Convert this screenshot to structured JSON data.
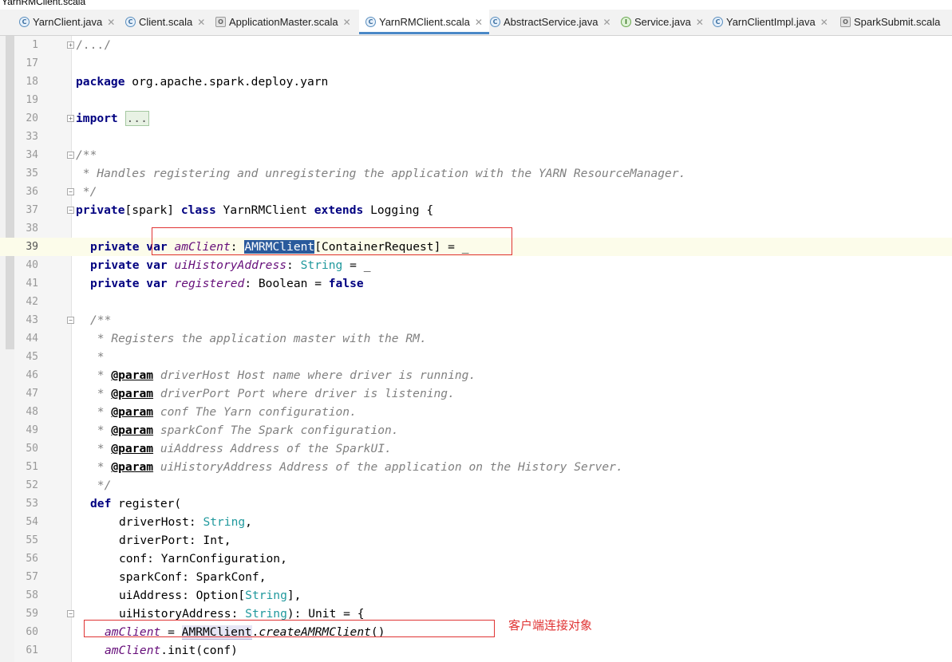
{
  "window": {
    "title": "YarnRMClient.scala"
  },
  "tabs": [
    {
      "label": "YarnClient.java",
      "icon": "class-icon",
      "active": false
    },
    {
      "label": "Client.scala",
      "icon": "class-icon",
      "active": false
    },
    {
      "label": "ApplicationMaster.scala",
      "icon": "object-icon",
      "active": false
    },
    {
      "label": "YarnRMClient.scala",
      "icon": "class-icon",
      "active": true
    },
    {
      "label": "AbstractService.java",
      "icon": "class-icon",
      "active": false
    },
    {
      "label": "Service.java",
      "icon": "interface-icon",
      "active": false
    },
    {
      "label": "YarnClientImpl.java",
      "icon": "class-icon",
      "active": false
    },
    {
      "label": "SparkSubmit.scala",
      "icon": "object-icon",
      "active": false
    }
  ],
  "editor": {
    "current_line": "39",
    "line_numbers": [
      "1",
      "17",
      "18",
      "19",
      "20",
      "33",
      "34",
      "35",
      "36",
      "37",
      "38",
      "39",
      "40",
      "41",
      "42",
      "43",
      "44",
      "45",
      "46",
      "47",
      "48",
      "49",
      "50",
      "51",
      "52",
      "53",
      "54",
      "55",
      "56",
      "57",
      "58",
      "59",
      "60",
      "61"
    ],
    "code": {
      "l1": "/.../",
      "l18_kw": "package",
      "l18_rest": " org.apache.spark.deploy.yarn",
      "l20_kw": "import",
      "l20_fold": "...",
      "l34": "/**",
      "l35": " * Handles registering and unregistering the application with the YARN ResourceManager.",
      "l36": " */",
      "l37_kw1": "private",
      "l37_a": "[spark] ",
      "l37_kw2": "class",
      "l37_b": " YarnRMClient ",
      "l37_kw3": "extends",
      "l37_c": " Logging {",
      "l39_kw": "private var",
      "l39_fld": "amClient",
      "l39_a": ": ",
      "l39_sel": "AMRMClient",
      "l39_b": "[ContainerRequest] = _",
      "l40_kw": "private var",
      "l40_fld": "uiHistoryAddress",
      "l40_a": ": ",
      "l40_typ": "String",
      "l40_b": " = _",
      "l41_kw": "private var",
      "l41_fld": "registered",
      "l41_a": ": Boolean = ",
      "l41_kw2": "false",
      "l43": "/**",
      "l44": " * Registers the application master with the RM.",
      "l45": " *",
      "star": " * ",
      "param": "@param",
      "l46_text": " driverHost Host name where driver is running.",
      "l47_text": " driverPort Port where driver is listening.",
      "l48_text": " conf The Yarn configuration.",
      "l49_text": " sparkConf The Spark configuration.",
      "l50_text": " uiAddress Address of the SparkUI.",
      "l51_text": " uiHistoryAddress Address of the application on the History Server.",
      "l52": " */",
      "l53_kw": "def",
      "l53_rest": " register(",
      "l54_a": "driverHost: ",
      "l54_typ": "String",
      "l54_b": ",",
      "l55": "driverPort: Int,",
      "l56": "conf: YarnConfiguration,",
      "l57": "sparkConf: SparkConf,",
      "l58_a": "uiAddress: Option[",
      "l58_typ": "String",
      "l58_b": "],",
      "l59_a": "uiHistoryAddress: ",
      "l59_typ": "String",
      "l59_b": "): Unit = {",
      "l60_fld": "amClient",
      "l60_a": " = ",
      "l60_id": "AMRMClient",
      "l60_b": ".",
      "l60_m": "createAMRMClient",
      "l60_c": "()",
      "l61_fld": "amClient",
      "l61_a": ".init(conf)"
    }
  },
  "annotation": {
    "text": "客户端连接对象",
    "color": "#e03434"
  }
}
